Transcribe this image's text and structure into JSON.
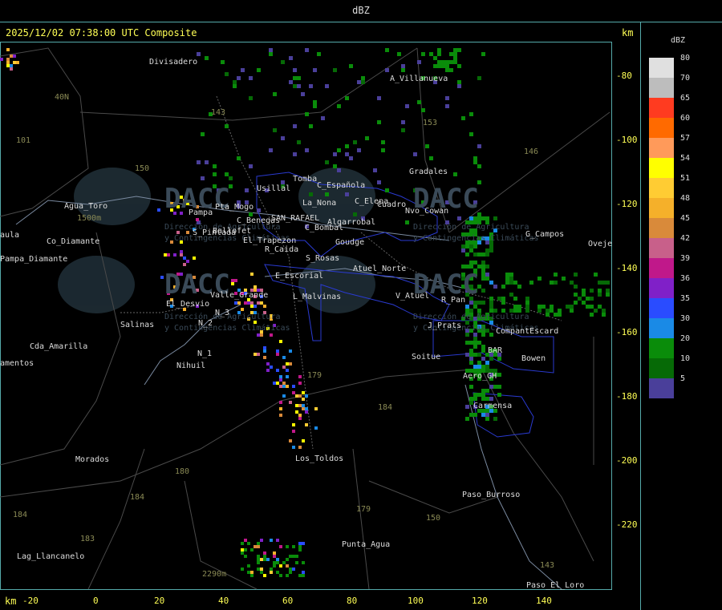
{
  "header": {
    "title": "dBZ"
  },
  "map": {
    "timestamp": "2025/12/02 07:38:00 UTC Composite",
    "axis_unit": "km",
    "x_ticks": [
      "-20",
      "0",
      "20",
      "40",
      "60",
      "80",
      "100",
      "120",
      "140"
    ],
    "y_ticks": [
      "-80",
      "-100",
      "-120",
      "-140",
      "-160",
      "-180",
      "-200",
      "-220"
    ],
    "watermark": {
      "logo_text": "DACC",
      "line1": "Dirección de Agricultura",
      "line2": "y Contingencias Climáticas"
    },
    "places": [
      "Divisadero",
      "A_Villanueva",
      "40N",
      "101",
      "143",
      "153",
      "150",
      "146",
      "Agua_Toro",
      "1500m",
      "Co_Diamante",
      "aula",
      "Pampa_Diamante",
      "Tomba",
      "Usillal",
      "C_Española",
      "Gradales",
      "La_Nona",
      "C_Elepa",
      "Cuadro",
      "Nvo_Cowan",
      "Pta_Mogo",
      "Pampa",
      "C_Benegas",
      "SAN_RAFAEL",
      "Algarrobal",
      "C_Bombal",
      "Ballofet",
      "El_Trapezon",
      "Goudge",
      "S_Pintada",
      "R_Caida",
      "S_Rosas",
      "G_Campos",
      "Oveje",
      "Atuel_Norte",
      "E_Escorial",
      "El_Desvio",
      "Valle_Grande",
      "L_Malvinas",
      "V_Atuel",
      "R_Pan",
      "Salinas",
      "N_2",
      "N_3",
      "J_Prats",
      "CompantEscard",
      "Cda_Amarilla",
      "amentos",
      "N_1",
      "Nihuil",
      "Soitue",
      "BAR",
      "Bowen",
      "Aero_GH",
      "Carmensa",
      "179",
      "184",
      "Morados",
      "Los_Toldos",
      "180",
      "184",
      "Paso_Burroso",
      "179",
      "150",
      "184",
      "183",
      "Punta_Agua",
      "Lag_Llancanelo",
      "2290m",
      "143",
      "Paso_El_Loro"
    ]
  },
  "legend": {
    "title": "dBZ",
    "items": [
      {
        "label": "80",
        "color": "#e0e0e0"
      },
      {
        "label": "70",
        "color": "#bdbdbd"
      },
      {
        "label": "65",
        "color": "#ff3b20"
      },
      {
        "label": "60",
        "color": "#ff6a00"
      },
      {
        "label": "57",
        "color": "#ff9a5a"
      },
      {
        "label": "54",
        "color": "#ffff00"
      },
      {
        "label": "51",
        "color": "#ffcc33"
      },
      {
        "label": "48",
        "color": "#f5b02a"
      },
      {
        "label": "45",
        "color": "#d98a3a"
      },
      {
        "label": "42",
        "color": "#c8608a"
      },
      {
        "label": "39",
        "color": "#c0188a"
      },
      {
        "label": "36",
        "color": "#8020c8"
      },
      {
        "label": "35",
        "color": "#2a4cff"
      },
      {
        "label": "30",
        "color": "#1a8ae6"
      },
      {
        "label": "20",
        "color": "#0a8c0a"
      },
      {
        "label": "10",
        "color": "#066a06"
      },
      {
        "label": "5",
        "color": "#4a3f9a"
      }
    ]
  }
}
